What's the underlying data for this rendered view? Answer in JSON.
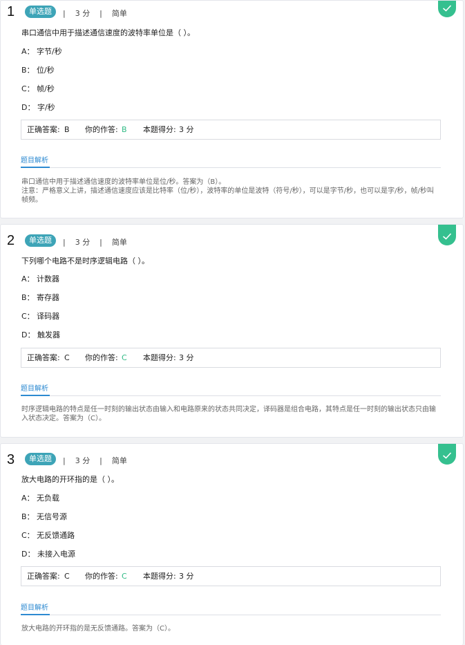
{
  "questions": [
    {
      "number": "1",
      "badge": "单选题",
      "meta": "|    3 分    |    简单",
      "stem": "串口通信中用于描述通信速度的波特率单位是（ ）。",
      "options": [
        "A： 字节/秒",
        "B： 位/秒",
        "C： 帧/秒",
        "D： 字/秒"
      ],
      "result": {
        "correct_label": "正确答案:",
        "correct_value": "B",
        "yours_label": "你的作答:",
        "yours_value": "B",
        "score_label": "本题得分:",
        "score_value": "3 分"
      },
      "analysis_tab": "题目解析",
      "explanation": [
        "串口通信中用于描述通信速度的波特率单位是位/秒。答案为（B）。",
        "注意：严格意义上讲，描述通信速度应该是比特率（位/秒），波特率的单位是波特（符号/秒），可以是字节/秒，也可以是字/秒，帧/秒叫帧频。"
      ]
    },
    {
      "number": "2",
      "badge": "单选题",
      "meta": "|    3 分    |    简单",
      "stem": "下列哪个电路不是时序逻辑电路（ ）。",
      "options": [
        "A： 计数器",
        "B： 寄存器",
        "C： 译码器",
        "D： 触发器"
      ],
      "result": {
        "correct_label": "正确答案:",
        "correct_value": "C",
        "yours_label": "你的作答:",
        "yours_value": "C",
        "score_label": "本题得分:",
        "score_value": "3 分"
      },
      "analysis_tab": "题目解析",
      "explanation": [
        "时序逻辑电路的特点是任一时刻的输出状态由输入和电路原来的状态共同决定，译码器是组合电路，其特点是任一时刻的输出状态只由输入状态决定。答案为（C）。"
      ]
    },
    {
      "number": "3",
      "badge": "单选题",
      "meta": "|    3 分    |    简单",
      "stem": "放大电路的开环指的是（ ）。",
      "options": [
        "A： 无负载",
        "B： 无信号源",
        "C： 无反馈通路",
        "D： 未接入电源"
      ],
      "result": {
        "correct_label": "正确答案:",
        "correct_value": "C",
        "yours_label": "你的作答:",
        "yours_value": "C",
        "score_label": "本题得分:",
        "score_value": "3 分"
      },
      "analysis_tab": "题目解析",
      "explanation": [
        "放大电路的开环指的是无反馈通路。答案为（C）。"
      ]
    }
  ],
  "icons": {
    "status": "check-icon"
  },
  "colors": {
    "badge": "#3da4b7",
    "correct": "#35c08f",
    "link": "#2d8ad1"
  }
}
